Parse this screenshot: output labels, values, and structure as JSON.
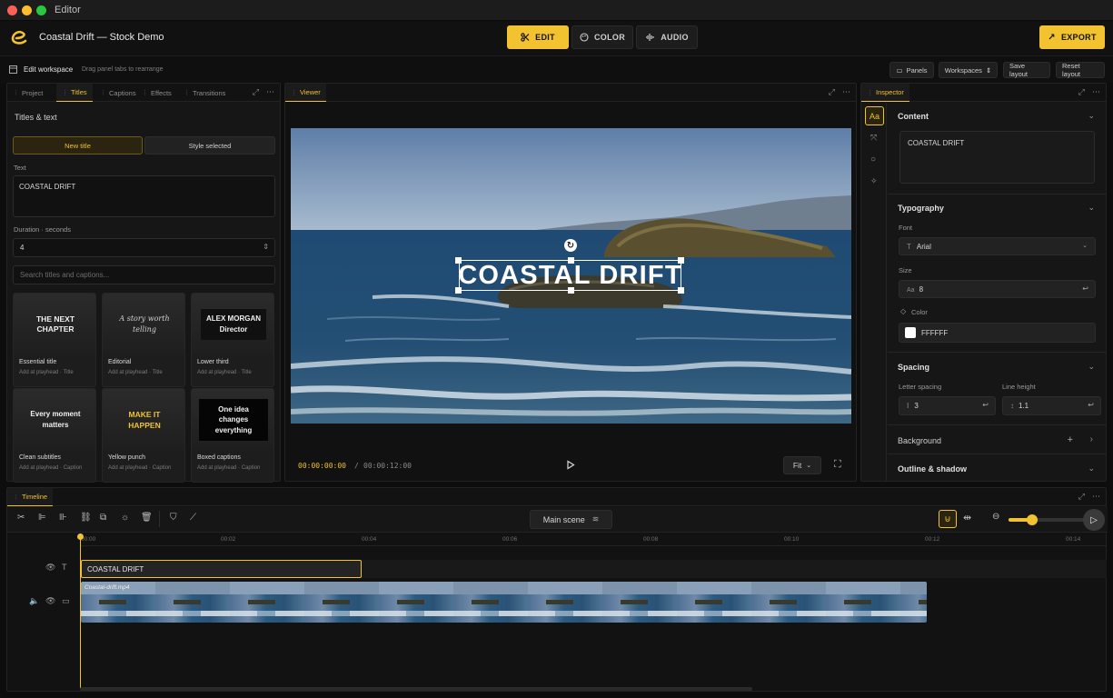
{
  "window": {
    "title": "Editor"
  },
  "header": {
    "project_title": "Coastal Drift — Stock Demo",
    "modes": [
      {
        "label": "EDIT",
        "icon": "scissors-icon",
        "active": true
      },
      {
        "label": "COLOR",
        "icon": "palette-icon",
        "active": false
      },
      {
        "label": "AUDIO",
        "icon": "waveform-icon",
        "active": false
      }
    ],
    "export_label": "EXPORT"
  },
  "workspace": {
    "title": "Edit workspace",
    "hint": "Drag panel tabs to rearrange",
    "buttons": {
      "panels": "Panels",
      "workspaces": "Workspaces",
      "save_layout": "Save layout",
      "reset_layout": "Reset layout"
    }
  },
  "left_panel": {
    "tabs": [
      "Project",
      "Titles",
      "Captions",
      "Effects",
      "Transitions"
    ],
    "active_tab": "Titles",
    "heading": "Titles & text",
    "new_title": "New title",
    "style_selected": "Style selected",
    "text_label": "Text",
    "text_value": "COASTAL DRIFT",
    "duration_label": "Duration · seconds",
    "duration_value": "4",
    "search_placeholder": "Search titles and captions...",
    "presets": [
      {
        "preview": "THE NEXT CHAPTER",
        "name": "Essential title",
        "sub": "Add at playhead · Title"
      },
      {
        "preview": "A story worth telling",
        "name": "Editorial",
        "sub": "Add at playhead · Title"
      },
      {
        "preview": "ALEX MORGAN Director",
        "name": "Lower third",
        "sub": "Add at playhead · Title"
      },
      {
        "preview": "Every moment matters",
        "name": "Clean subtitles",
        "sub": "Add at playhead · Caption"
      },
      {
        "preview": "MAKE IT HAPPEN",
        "name": "Yellow punch",
        "sub": "Add at playhead · Caption"
      },
      {
        "preview": "One idea changes everything",
        "name": "Boxed captions",
        "sub": "Add at playhead · Caption"
      }
    ]
  },
  "viewer": {
    "tab": "Viewer",
    "overlay_title": "COASTAL DRIFT",
    "timecode_current": "00:00:00:00",
    "timecode_sep": "/",
    "timecode_total": "00:00:12:00",
    "fit_label": "Fit"
  },
  "inspector": {
    "tab": "Inspector",
    "content_heading": "Content",
    "content_text": "COASTAL DRIFT",
    "typography_heading": "Typography",
    "font_label": "Font",
    "font_value": "Arial",
    "size_label": "Size",
    "size_value": "8",
    "color_label": "Color",
    "color_value": "FFFFFF",
    "spacing_heading": "Spacing",
    "letter_spacing_label": "Letter spacing",
    "letter_spacing_value": "3",
    "line_height_label": "Line height",
    "line_height_value": "1.1",
    "background_heading": "Background",
    "outline_heading": "Outline & shadow"
  },
  "timeline": {
    "tab": "Timeline",
    "scene": "Main scene",
    "ticks": [
      "00:00",
      "00:02",
      "00:04",
      "00:06",
      "00:08",
      "00:10",
      "00:12",
      "00:14"
    ],
    "title_clip": "COASTAL DRIFT",
    "video_clip": "Coastal-drift.mp4",
    "zoom_level": 0.3
  },
  "colors": {
    "accent": "#f2c230",
    "background": "#0d0d0d",
    "panel": "#161616"
  }
}
